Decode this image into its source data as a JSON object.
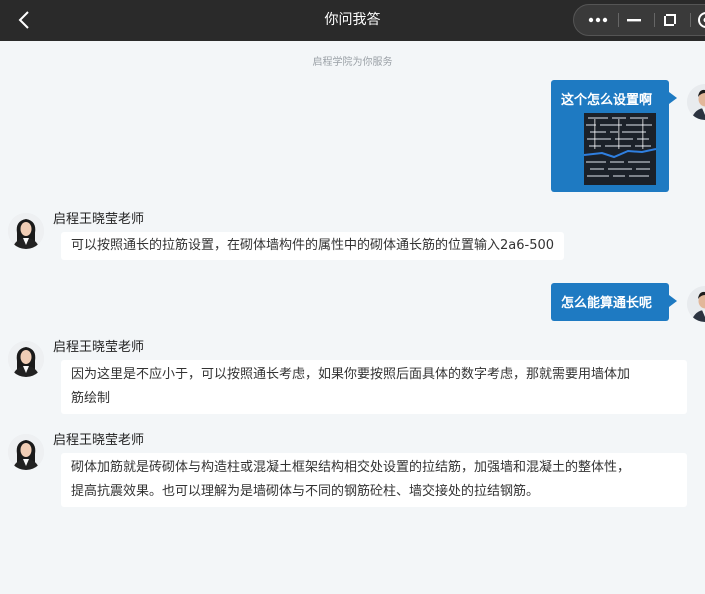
{
  "header": {
    "title": "你问我答",
    "back_icon": "chevron-left-icon",
    "capsule_icons": [
      "more-icon",
      "minimize-icon",
      "restore-icon",
      "close-target-icon"
    ]
  },
  "notice": "启程学院为你服务",
  "messages": [
    {
      "role": "user",
      "text": "这个怎么设置啊",
      "has_image": true
    },
    {
      "role": "teacher",
      "sender": "启程王晓莹老师",
      "text": "可以按照通长的拉筋设置，在砌体墙构件的属性中的砌体通长筋的位置输入2a6-500"
    },
    {
      "role": "user",
      "text": "怎么能算通长呢"
    },
    {
      "role": "teacher",
      "sender": "启程王晓莹老师",
      "lines": [
        "因为这里是不应小于，可以按照通长考虑，如果你要按照后面具体的数字考虑，那就需要用墙体加",
        "筋绘制"
      ]
    },
    {
      "role": "teacher",
      "sender": "启程王晓莹老师",
      "lines": [
        "砌体加筋就是砖砌体与构造柱或混凝土框架结构相交处设置的拉结筋，加强墙和混凝土的整体性，",
        "提高抗震效果。也可以理解为是墙砌体与不同的钢筋砼柱、墙交接处的拉结钢筋。"
      ]
    }
  ],
  "colors": {
    "header_bg": "#2a2a2a",
    "user_bubble": "#1e7ac2",
    "page_bg": "#f3f6f8",
    "teacher_bubble": "#ffffff"
  }
}
